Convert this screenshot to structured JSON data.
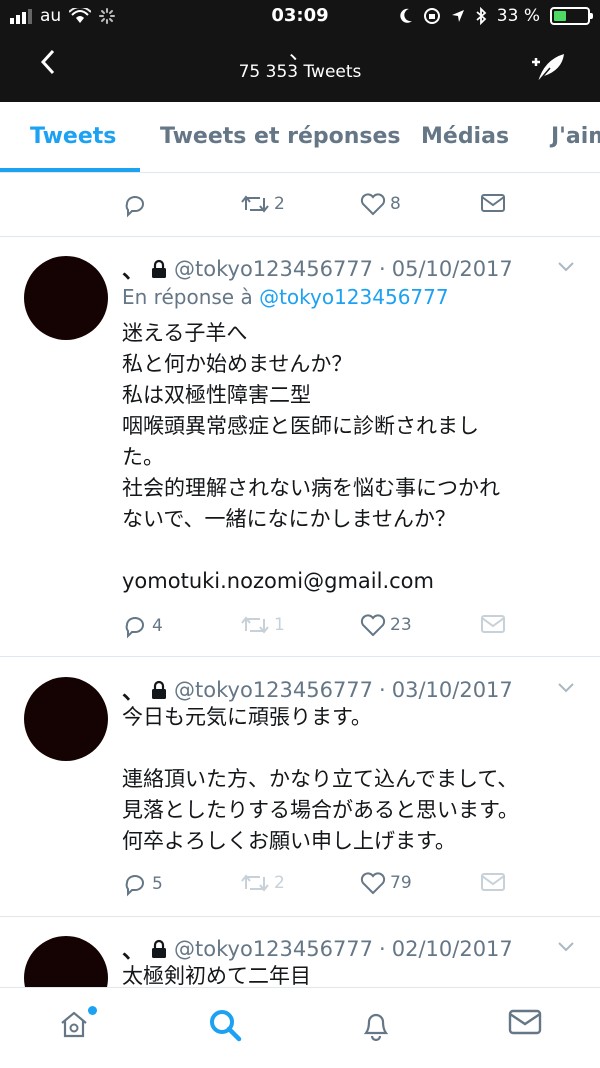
{
  "status_bar": {
    "carrier": "au",
    "time": "03:09",
    "battery": "33 %"
  },
  "nav": {
    "title_mark": "、",
    "tweet_count": "75 353 Tweets"
  },
  "tabs": [
    {
      "label": "Tweets"
    },
    {
      "label": "Tweets et réponses"
    },
    {
      "label": "Médias"
    },
    {
      "label": "J'aime"
    }
  ],
  "top_actions": {
    "retweets": "2",
    "likes": "8"
  },
  "tweets": [
    {
      "name": "、",
      "handle": "@tokyo123456777",
      "separator": "·",
      "date": "05/10/2017",
      "reply_prefix": "En réponse à",
      "reply_handle": "@tokyo123456777",
      "lines": [
        "迷える子羊へ",
        "私と何か始めませんか？",
        "私は双極性障害二型",
        "咽喉頭異常感症と医師に診断されまし",
        "た。",
        "社会的理解されない病を悩む事につかれ",
        "ないで、一緒になにかしませんか？",
        "",
        "yomotuki.nozomi@gmail.com"
      ],
      "replies": "4",
      "retweets": "1",
      "likes": "23"
    },
    {
      "name": "、",
      "handle": "@tokyo123456777",
      "separator": "·",
      "date": "03/10/2017",
      "lines": [
        "今日も元気に頑張ります。",
        "",
        "連絡頂いた方、かなり立て込んでまして、",
        "見落としたりする場合があると思います。",
        "何卒よろしくお願い申し上げます。"
      ],
      "replies": "5",
      "retweets": "2",
      "likes": "79"
    },
    {
      "name": "、",
      "handle": "@tokyo123456777",
      "separator": "·",
      "date": "02/10/2017",
      "lines": [
        "太極剣初めて二年目"
      ]
    }
  ],
  "colors": {
    "accent": "#1da1f2",
    "header_bg": "#141414",
    "muted": "#657786",
    "faded": "#c8d1d8"
  },
  "icons": {
    "reply": "reply-icon",
    "retweet": "retweet-icon",
    "like": "heart-icon",
    "dm": "envelope-icon",
    "home": "home-icon",
    "search": "search-icon",
    "notifications": "bell-icon",
    "messages": "mail-icon"
  }
}
